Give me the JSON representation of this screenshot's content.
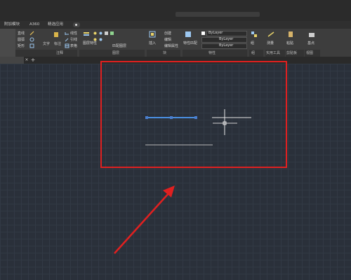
{
  "ribbon_tabs": [
    {
      "label": "附加模块"
    },
    {
      "label": "A360"
    },
    {
      "label": "精选应用"
    }
  ],
  "ribbon": {
    "draw_labels": [
      "直线",
      "圆弧",
      "矩形"
    ],
    "text_label": "文字",
    "mark_label": "标注",
    "line_label": "线性",
    "leader_label": "引线",
    "table_label": "表格",
    "layer_props_label": "图层特性",
    "layer_match_label": "匹配图层",
    "insert_label": "插入",
    "create_label": "创建",
    "edit_label": "编辑",
    "edit_attr_label": "编辑属性",
    "match_props_label": "特性匹配",
    "bylayer_1": "ByLayer",
    "bylayer_2": "ByLayer",
    "bylayer_3": "ByLayer",
    "group_label": "组",
    "utilities_label": "实用工具",
    "clipboard_label": "剪贴板",
    "view_label": "视图",
    "measure_label": "测量",
    "paste_label": "粘贴",
    "base_label": "基点",
    "panels": {
      "annotation": "注释",
      "layers": "图层",
      "block": "块",
      "properties": "特性",
      "groups": "组",
      "utilities": "实用工具",
      "clipboard": "剪贴板",
      "view": "视图"
    }
  },
  "doc_tab": {
    "close_glyph": "×",
    "add_glyph": "+"
  },
  "colors": {
    "canvas_bg": "#2a303a",
    "grid": "#323945",
    "selected_line": "#4a90e2",
    "grip": "#4a7fd0",
    "annotation_red": "#e02020",
    "crosshair": "#e6e6e6",
    "line": "#b8b8b8"
  }
}
